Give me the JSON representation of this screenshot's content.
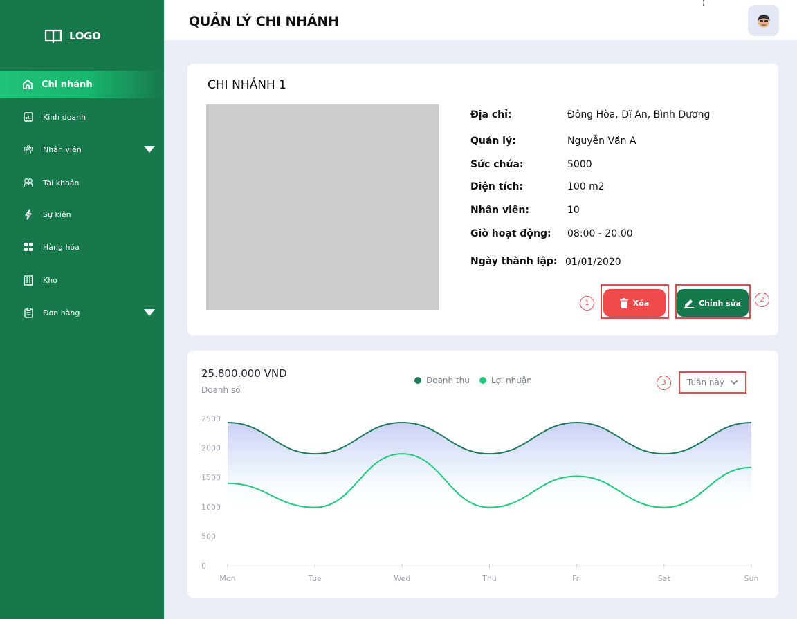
{
  "logo": {
    "text": "LOGO",
    "icon": "book-icon"
  },
  "sidebar": {
    "items": [
      {
        "label": "Chi nhánh",
        "icon": "home-icon",
        "active": true
      },
      {
        "label": "Kinh doanh",
        "icon": "bar-chart-icon"
      },
      {
        "label": "Nhân viên",
        "icon": "team-icon",
        "expandable": true
      },
      {
        "label": "Tài khoản",
        "icon": "users-icon"
      },
      {
        "label": "Sự kiện",
        "icon": "lightning-icon"
      },
      {
        "label": "Hàng hóa",
        "icon": "grid-icon"
      },
      {
        "label": "Kho",
        "icon": "building-icon"
      },
      {
        "label": "Đơn hàng",
        "icon": "clipboard-icon",
        "expandable": true
      }
    ]
  },
  "header": {
    "title": "QUẢN LÝ CHI NHÁNH",
    "mark": ")"
  },
  "branch": {
    "title": "CHI NHÁNH 1",
    "fields": [
      {
        "label": "Địa chỉ:",
        "value": "Đông Hòa, Dĩ An, Bình Dương"
      },
      {
        "label": "Quản lý:",
        "value": "Nguyễn Văn A"
      },
      {
        "label": "Sức chứa:",
        "value": "5000"
      },
      {
        "label": "Diện tích:",
        "value": "100 m2"
      },
      {
        "label": "Nhân viên:",
        "value": "10"
      },
      {
        "label": "Giờ hoạt động:",
        "value": "08:00 - 20:00"
      },
      {
        "label": "Ngày thành lập:",
        "value": "01/01/2020"
      }
    ],
    "delete_label": "Xóa",
    "edit_label": "Chỉnh sửa",
    "annotations": [
      "1",
      "2",
      "3"
    ]
  },
  "sales": {
    "value": "25.800.000 VND",
    "label": "Doanh số",
    "period": "Tuần này"
  },
  "colors": {
    "brand": "#17784b",
    "revenue": "#1f7a5a",
    "profit": "#1ecb7a",
    "delete": "#f14a4a",
    "annotation": "#e8494b"
  },
  "chart_data": {
    "type": "area",
    "x": [
      "Mon",
      "Tue",
      "Wed",
      "Thu",
      "Fri",
      "Sat",
      "Sun"
    ],
    "yticks": [
      0,
      500,
      1000,
      1500,
      2000,
      2500
    ],
    "ylim": [
      0,
      2500
    ],
    "grid": false,
    "legend": "top",
    "series": [
      {
        "name": "Doanh thu",
        "values": [
          2430,
          1900,
          2430,
          1900,
          2430,
          1900,
          2430
        ]
      },
      {
        "name": "Lợi nhuận",
        "values": [
          1400,
          990,
          1900,
          990,
          1520,
          990,
          1670
        ]
      }
    ]
  }
}
